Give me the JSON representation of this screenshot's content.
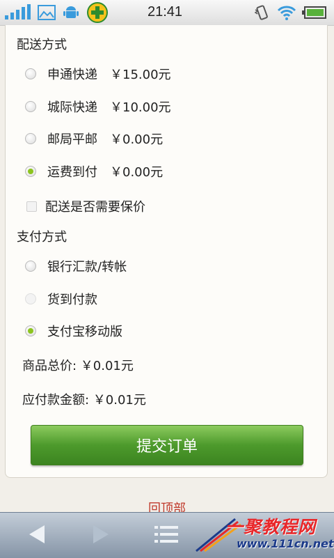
{
  "status_bar": {
    "time": "21:41",
    "icons": [
      "signal-icon",
      "image-icon",
      "android-icon",
      "security-app-icon",
      "vibrate-icon",
      "wifi-icon",
      "battery-icon"
    ]
  },
  "shipping": {
    "title": "配送方式",
    "options": [
      {
        "label": "申通快递",
        "price": "￥15.00元",
        "checked": false
      },
      {
        "label": "城际快递",
        "price": "￥10.00元",
        "checked": false
      },
      {
        "label": "邮局平邮",
        "price": "￥0.00元",
        "checked": false
      },
      {
        "label": "运费到付",
        "price": "￥0.00元",
        "checked": true
      }
    ],
    "insurance_label": "配送是否需要保价"
  },
  "payment": {
    "title": "支付方式",
    "options": [
      {
        "label": "银行汇款/转帐",
        "checked": false,
        "disabled": false
      },
      {
        "label": "货到付款",
        "checked": false,
        "disabled": true
      },
      {
        "label": "支付宝移动版",
        "checked": true,
        "disabled": false
      }
    ]
  },
  "summary": {
    "goods_total": "商品总价: ￥0.01元",
    "amount_due": "应付款金额: ￥0.01元"
  },
  "submit_label": "提交订单",
  "back_to_top": "回顶部",
  "watermark": {
    "brand": "一聚教程网",
    "url": "www.111cn.net"
  },
  "colors": {
    "accent_green": "#4d9a2c",
    "radio_checked": "#8cc41f",
    "link_red": "#c0392b"
  }
}
